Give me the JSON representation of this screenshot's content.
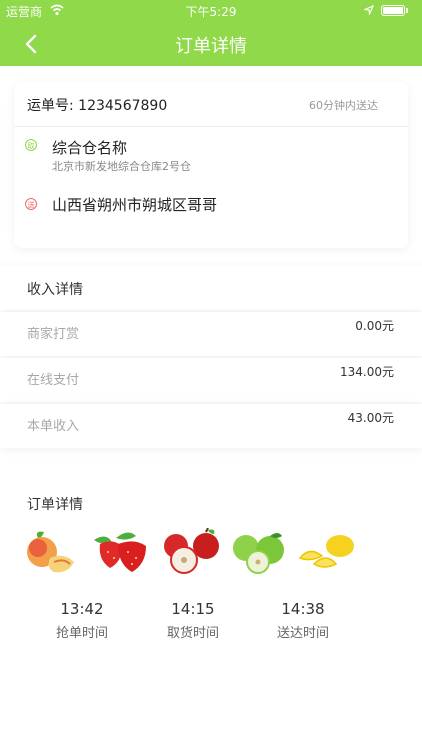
{
  "status_bar": {
    "carrier": "运营商",
    "time": "下午5:29",
    "icons": [
      "wifi-icon",
      "location-arrow-icon",
      "battery-icon"
    ]
  },
  "nav": {
    "title": "订单详情",
    "back_icon": "chevron-left-icon"
  },
  "order": {
    "waybill": "运单号: 1234567890",
    "eta": "60分钟内送达",
    "pickup_tag": "取",
    "warehouse_name": "综合仓名称",
    "warehouse_address": "北京市新发地综合仓库2号仓",
    "deliver_tag": "送",
    "destination": "山西省朔州市朔城区哥哥"
  },
  "income": {
    "title": "收入详情",
    "rows": [
      {
        "label": "商家打赏",
        "value": "0.00元"
      },
      {
        "label": "在线支付",
        "value": "134.00元"
      },
      {
        "label": "本单收入",
        "value": "43.00元"
      }
    ]
  },
  "detail": {
    "title": "订单详情",
    "items": [
      "peach",
      "strawberry",
      "red-apple",
      "green-apple",
      "lemon"
    ],
    "times": [
      {
        "time": "13:42",
        "label": "抢单时间"
      },
      {
        "time": "14:15",
        "label": "取货时间"
      },
      {
        "time": "14:38",
        "label": "送达时间"
      }
    ]
  },
  "colors": {
    "accent": "#8fd94a",
    "deliver": "#f26b6b"
  }
}
